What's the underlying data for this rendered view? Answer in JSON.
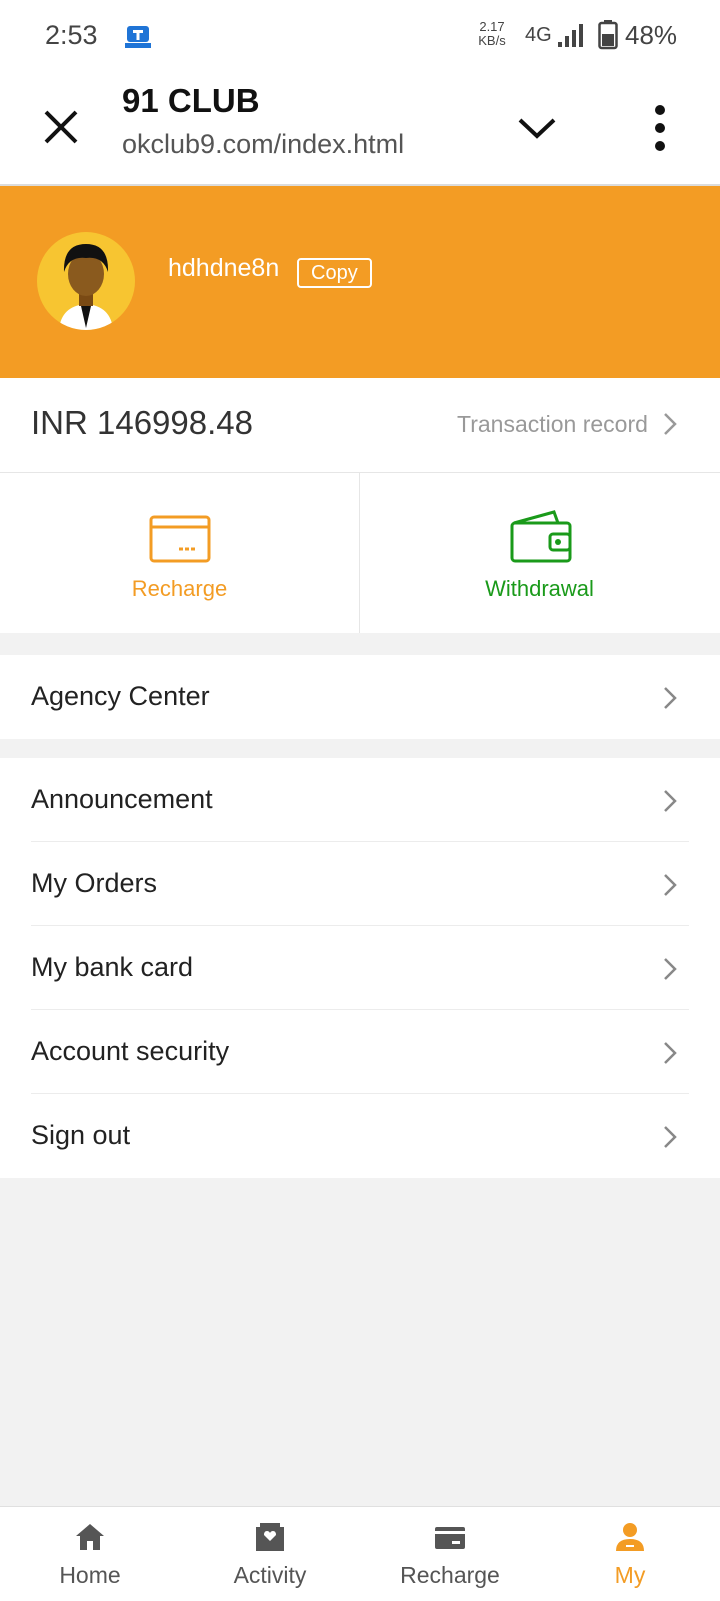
{
  "status_bar": {
    "time": "2:53",
    "speed_value": "2.17",
    "speed_unit": "KB/s",
    "network": "4G",
    "battery": "48%"
  },
  "browser": {
    "title": "91 CLUB",
    "url": "okclub9.com/index.html",
    "icons": [
      "close-icon",
      "chevron-down-icon",
      "more-vertical-icon"
    ]
  },
  "profile": {
    "username": "hdhdne8n",
    "copy_label": "Copy",
    "header_color": "#f39c24"
  },
  "balance": {
    "amount": "INR 146998.48",
    "transaction_label": "Transaction record"
  },
  "actions": {
    "recharge": {
      "label": "Recharge",
      "color": "#f39c24",
      "icon": "card-icon"
    },
    "withdrawal": {
      "label": "Withdrawal",
      "color": "#1a9a1a",
      "icon": "wallet-icon"
    }
  },
  "menu": {
    "agency": "Agency Center",
    "items": [
      {
        "label": "Announcement"
      },
      {
        "label": "My Orders"
      },
      {
        "label": "My bank card"
      },
      {
        "label": "Account security"
      },
      {
        "label": "Sign out"
      }
    ]
  },
  "bottom_nav": {
    "items": [
      {
        "label": "Home",
        "icon": "home-icon"
      },
      {
        "label": "Activity",
        "icon": "activity-icon"
      },
      {
        "label": "Recharge",
        "icon": "recharge-icon"
      },
      {
        "label": "My",
        "icon": "user-icon"
      }
    ],
    "active": "My",
    "active_color": "#f39c24"
  }
}
